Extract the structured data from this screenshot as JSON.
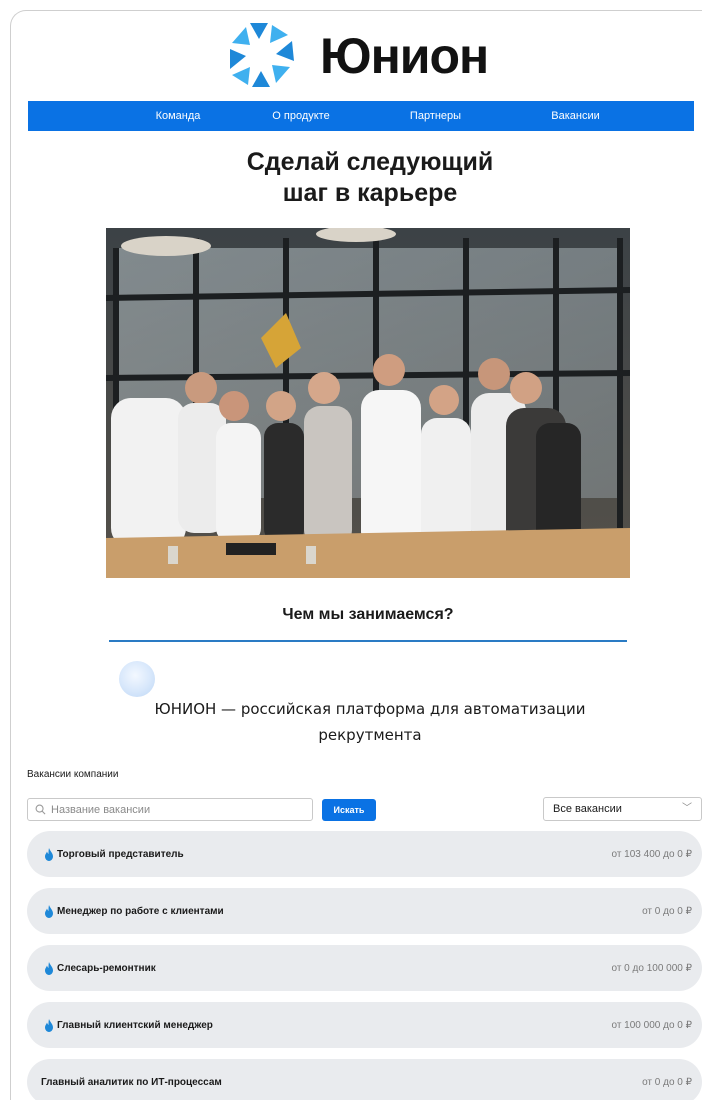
{
  "brand": {
    "name": "Юнион"
  },
  "nav": {
    "items": [
      {
        "label": "Команда"
      },
      {
        "label": "О продукте"
      },
      {
        "label": "Партнеры"
      },
      {
        "label": "Вакансии"
      }
    ]
  },
  "hero": {
    "title_line1": "Сделай следующий",
    "title_line2": "шаг в карьере"
  },
  "about": {
    "heading": "Чем мы занимаемся?",
    "description": "ЮНИОН — российская платформа для автоматизации рекрутмента"
  },
  "vacancies": {
    "title": "Вакансии компании",
    "search_placeholder": "Название вакансии",
    "search_button": "Искать",
    "filter_value": "Все вакансии",
    "items": [
      {
        "name": "Торговый представитель",
        "salary": "от 103 400 до 0 ₽",
        "hot": true
      },
      {
        "name": "Менеджер по работе с клиентами",
        "salary": "от 0 до 0 ₽",
        "hot": true
      },
      {
        "name": "Слесарь-ремонтник",
        "salary": "от 0 до 100 000 ₽",
        "hot": true
      },
      {
        "name": "Главный клиентский менеджер",
        "salary": "от 100 000 до 0 ₽",
        "hot": true
      },
      {
        "name": "Главный аналитик по ИТ-процессам",
        "salary": "от 0 до 0 ₽",
        "hot": false
      }
    ]
  },
  "colors": {
    "accent": "#0a72e4",
    "logo_blue": "#1e88d8",
    "logo_light": "#3fb0ef",
    "card_bg": "#e9ebee",
    "rule": "#2a7bc4"
  }
}
